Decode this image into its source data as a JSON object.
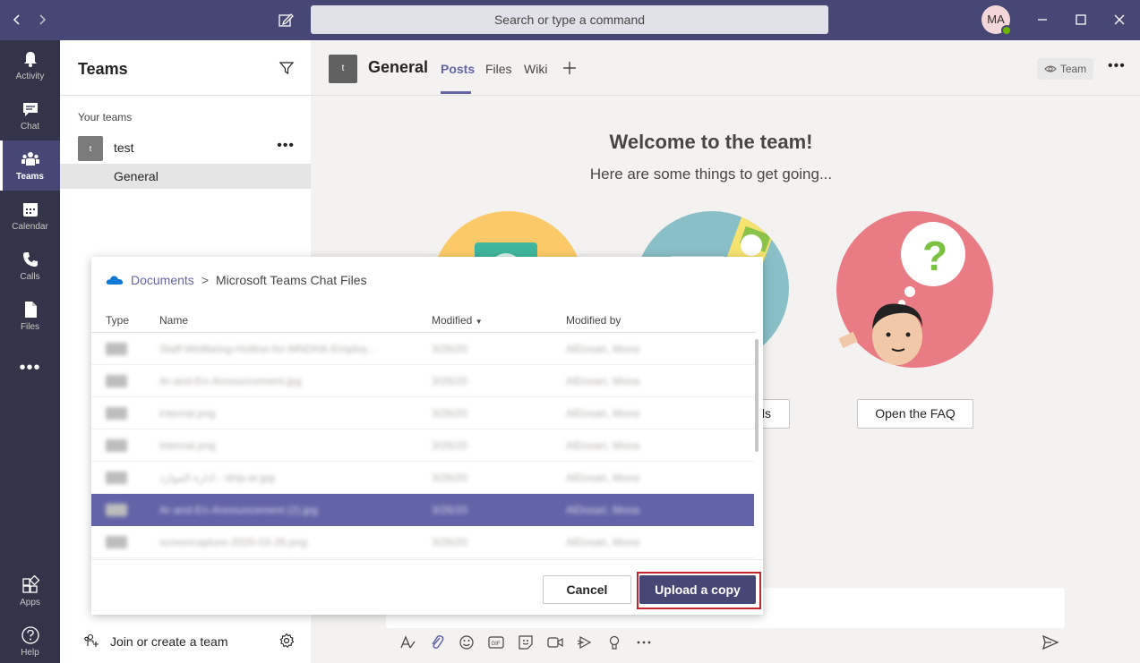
{
  "titlebar": {
    "search_placeholder": "Search or type a command",
    "avatar_initials": "MA",
    "presence_color": "#6bb700",
    "accent_color": "#464775"
  },
  "rail": {
    "items": [
      {
        "label": "Activity",
        "icon": "bell-icon"
      },
      {
        "label": "Chat",
        "icon": "chat-icon"
      },
      {
        "label": "Teams",
        "icon": "teams-icon",
        "active": true
      },
      {
        "label": "Calendar",
        "icon": "calendar-icon"
      },
      {
        "label": "Calls",
        "icon": "phone-icon"
      },
      {
        "label": "Files",
        "icon": "file-icon"
      }
    ],
    "more": "•••",
    "bottom_items": [
      {
        "label": "Apps",
        "icon": "apps-icon"
      },
      {
        "label": "Help",
        "icon": "help-icon"
      }
    ]
  },
  "teams_pane": {
    "title": "Teams",
    "section_label": "Your teams",
    "team": {
      "tile": "t",
      "name": "test",
      "more": "•••"
    },
    "channel": "General",
    "join_label": "Join or create a team"
  },
  "channel_header": {
    "tile": "t",
    "title": "General",
    "tabs": [
      "Posts",
      "Files",
      "Wiki"
    ],
    "active_tab": "Posts",
    "team_button": "Team",
    "more": "•••"
  },
  "welcome": {
    "title": "Welcome to the team!",
    "subtitle": "Here are some things to get going...",
    "tools_button_partial": "ls",
    "faq_button": "Open the FAQ"
  },
  "dialog": {
    "breadcrumb": {
      "root": "Documents",
      "separator": ">",
      "current": "Microsoft Teams Chat Files"
    },
    "columns": {
      "type": "Type",
      "name": "Name",
      "modified": "Modified",
      "modified_by": "Modified by"
    },
    "files": [
      {
        "name": "Staff-Wellbeing-Hotline-for-MNDHA-Employ...",
        "modified": "3/26/20",
        "modified_by": "AlDosari, Mona",
        "selected": false
      },
      {
        "name": "Ar-and-En-Announcement.jpg",
        "modified": "3/26/20",
        "modified_by": "AlDosari, Mona",
        "selected": false
      },
      {
        "name": "internal.png",
        "modified": "3/26/20",
        "modified_by": "AlDosari, Mona",
        "selected": false
      },
      {
        "name": "internal.png",
        "modified": "3/26/20",
        "modified_by": "AlDosari, Mona",
        "selected": false
      },
      {
        "name": "ادارة الموارد - strip-ar.jpg",
        "modified": "3/26/20",
        "modified_by": "AlDosari, Mona",
        "selected": false
      },
      {
        "name": "Ar-and-En-Announcement (2).jpg",
        "modified": "3/26/20",
        "modified_by": "AlDosari, Mona",
        "selected": true
      },
      {
        "name": "screencapture-2020-03-26.png",
        "modified": "3/26/20",
        "modified_by": "AlDosari, Mona",
        "selected": false
      }
    ],
    "cancel": "Cancel",
    "upload": "Upload a copy",
    "highlight_color": "#c4262e"
  },
  "compose": {
    "tools": [
      "format-icon",
      "attach-icon",
      "emoji-icon",
      "gif-icon",
      "sticker-icon",
      "meet-icon",
      "stream-icon",
      "praise-icon",
      "more-icon"
    ]
  }
}
